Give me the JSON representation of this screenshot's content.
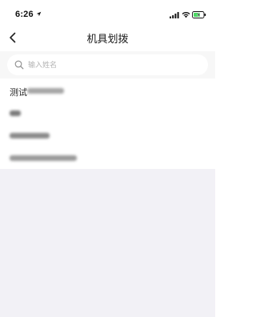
{
  "status_bar": {
    "time": "6:26",
    "icons": [
      "location-arrow-icon",
      "signal-icon",
      "wifi-icon",
      "battery-charging-icon"
    ],
    "battery_color": "#4cd964"
  },
  "nav": {
    "title": "机具划拨",
    "back_icon": "chevron-left-icon"
  },
  "search": {
    "placeholder": "输入姓名",
    "value": "",
    "icon": "search-icon"
  },
  "list": {
    "items": [
      {
        "label": "测试"
      },
      {
        "label": ""
      },
      {
        "label": ""
      },
      {
        "label": ""
      }
    ]
  },
  "colors": {
    "page_bg": "#ffffff",
    "search_section_bg": "#f7f7f7",
    "empty_area_bg": "#f2f1f6"
  }
}
